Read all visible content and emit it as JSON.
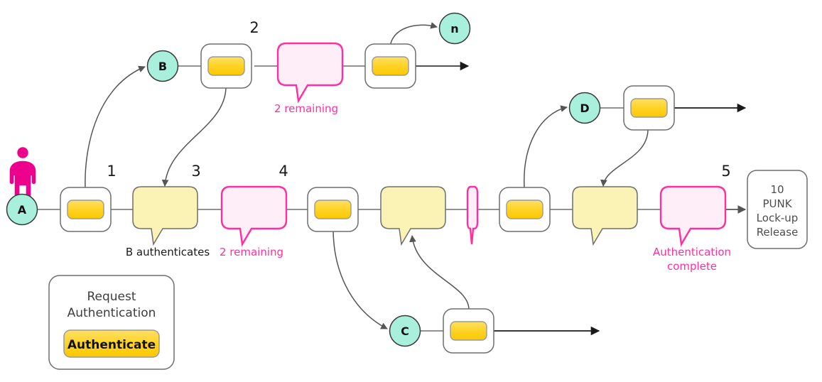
{
  "diagram": {
    "title_present": false,
    "colors": {
      "card_fill": "#ffffff",
      "card_stroke": "#6e6e6e",
      "button_fill": "#ffd42a",
      "button_stroke": "#9a9a9a",
      "node_fill": "#a8f0dc",
      "node_stroke": "#3a3a3a",
      "bubble_yellow_fill": "#fbf3b6",
      "bubble_yellow_stroke": "#6e6e6e",
      "bubble_pink_fill": "#fdeef7",
      "bubble_pink_stroke": "#ff2fa0",
      "accent_pink": "#ec008c",
      "line": "#6e6e6e",
      "arrow_dark": "#1a1a1a",
      "text_dark": "#1a1a1a",
      "text_gray": "#4d4d4d"
    },
    "actor": {
      "name": "user-actor-figure",
      "color": "#ec008c"
    },
    "nodes": [
      {
        "id": "A",
        "label": "A"
      },
      {
        "id": "B",
        "label": "B"
      },
      {
        "id": "C",
        "label": "C"
      },
      {
        "id": "D",
        "label": "D"
      },
      {
        "id": "n",
        "label": "n"
      }
    ],
    "step_numbers": [
      {
        "id": "step-1",
        "label": "1"
      },
      {
        "id": "step-2",
        "label": "2"
      },
      {
        "id": "step-3",
        "label": "3"
      },
      {
        "id": "step-4",
        "label": "4"
      },
      {
        "id": "step-5",
        "label": "5"
      }
    ],
    "captions": [
      {
        "id": "caption-b-authenticates",
        "text": "B authenticates",
        "color": "dark"
      },
      {
        "id": "caption-remaining-main",
        "text": "2 remaining",
        "color": "pink"
      },
      {
        "id": "caption-remaining-top",
        "text": "2 remaining",
        "color": "pink"
      },
      {
        "id": "caption-auth-complete-line1",
        "text": "Authentication",
        "color": "pink"
      },
      {
        "id": "caption-auth-complete-line2",
        "text": "complete",
        "color": "pink"
      }
    ],
    "end_box": {
      "name": "lockup-release-box",
      "lines": [
        "10",
        "PUNK",
        "Lock-up",
        "Release"
      ]
    },
    "legend": {
      "name": "request-authentication-legend",
      "title_line1": "Request",
      "title_line2": "Authentication",
      "button_label": "Authenticate"
    }
  }
}
